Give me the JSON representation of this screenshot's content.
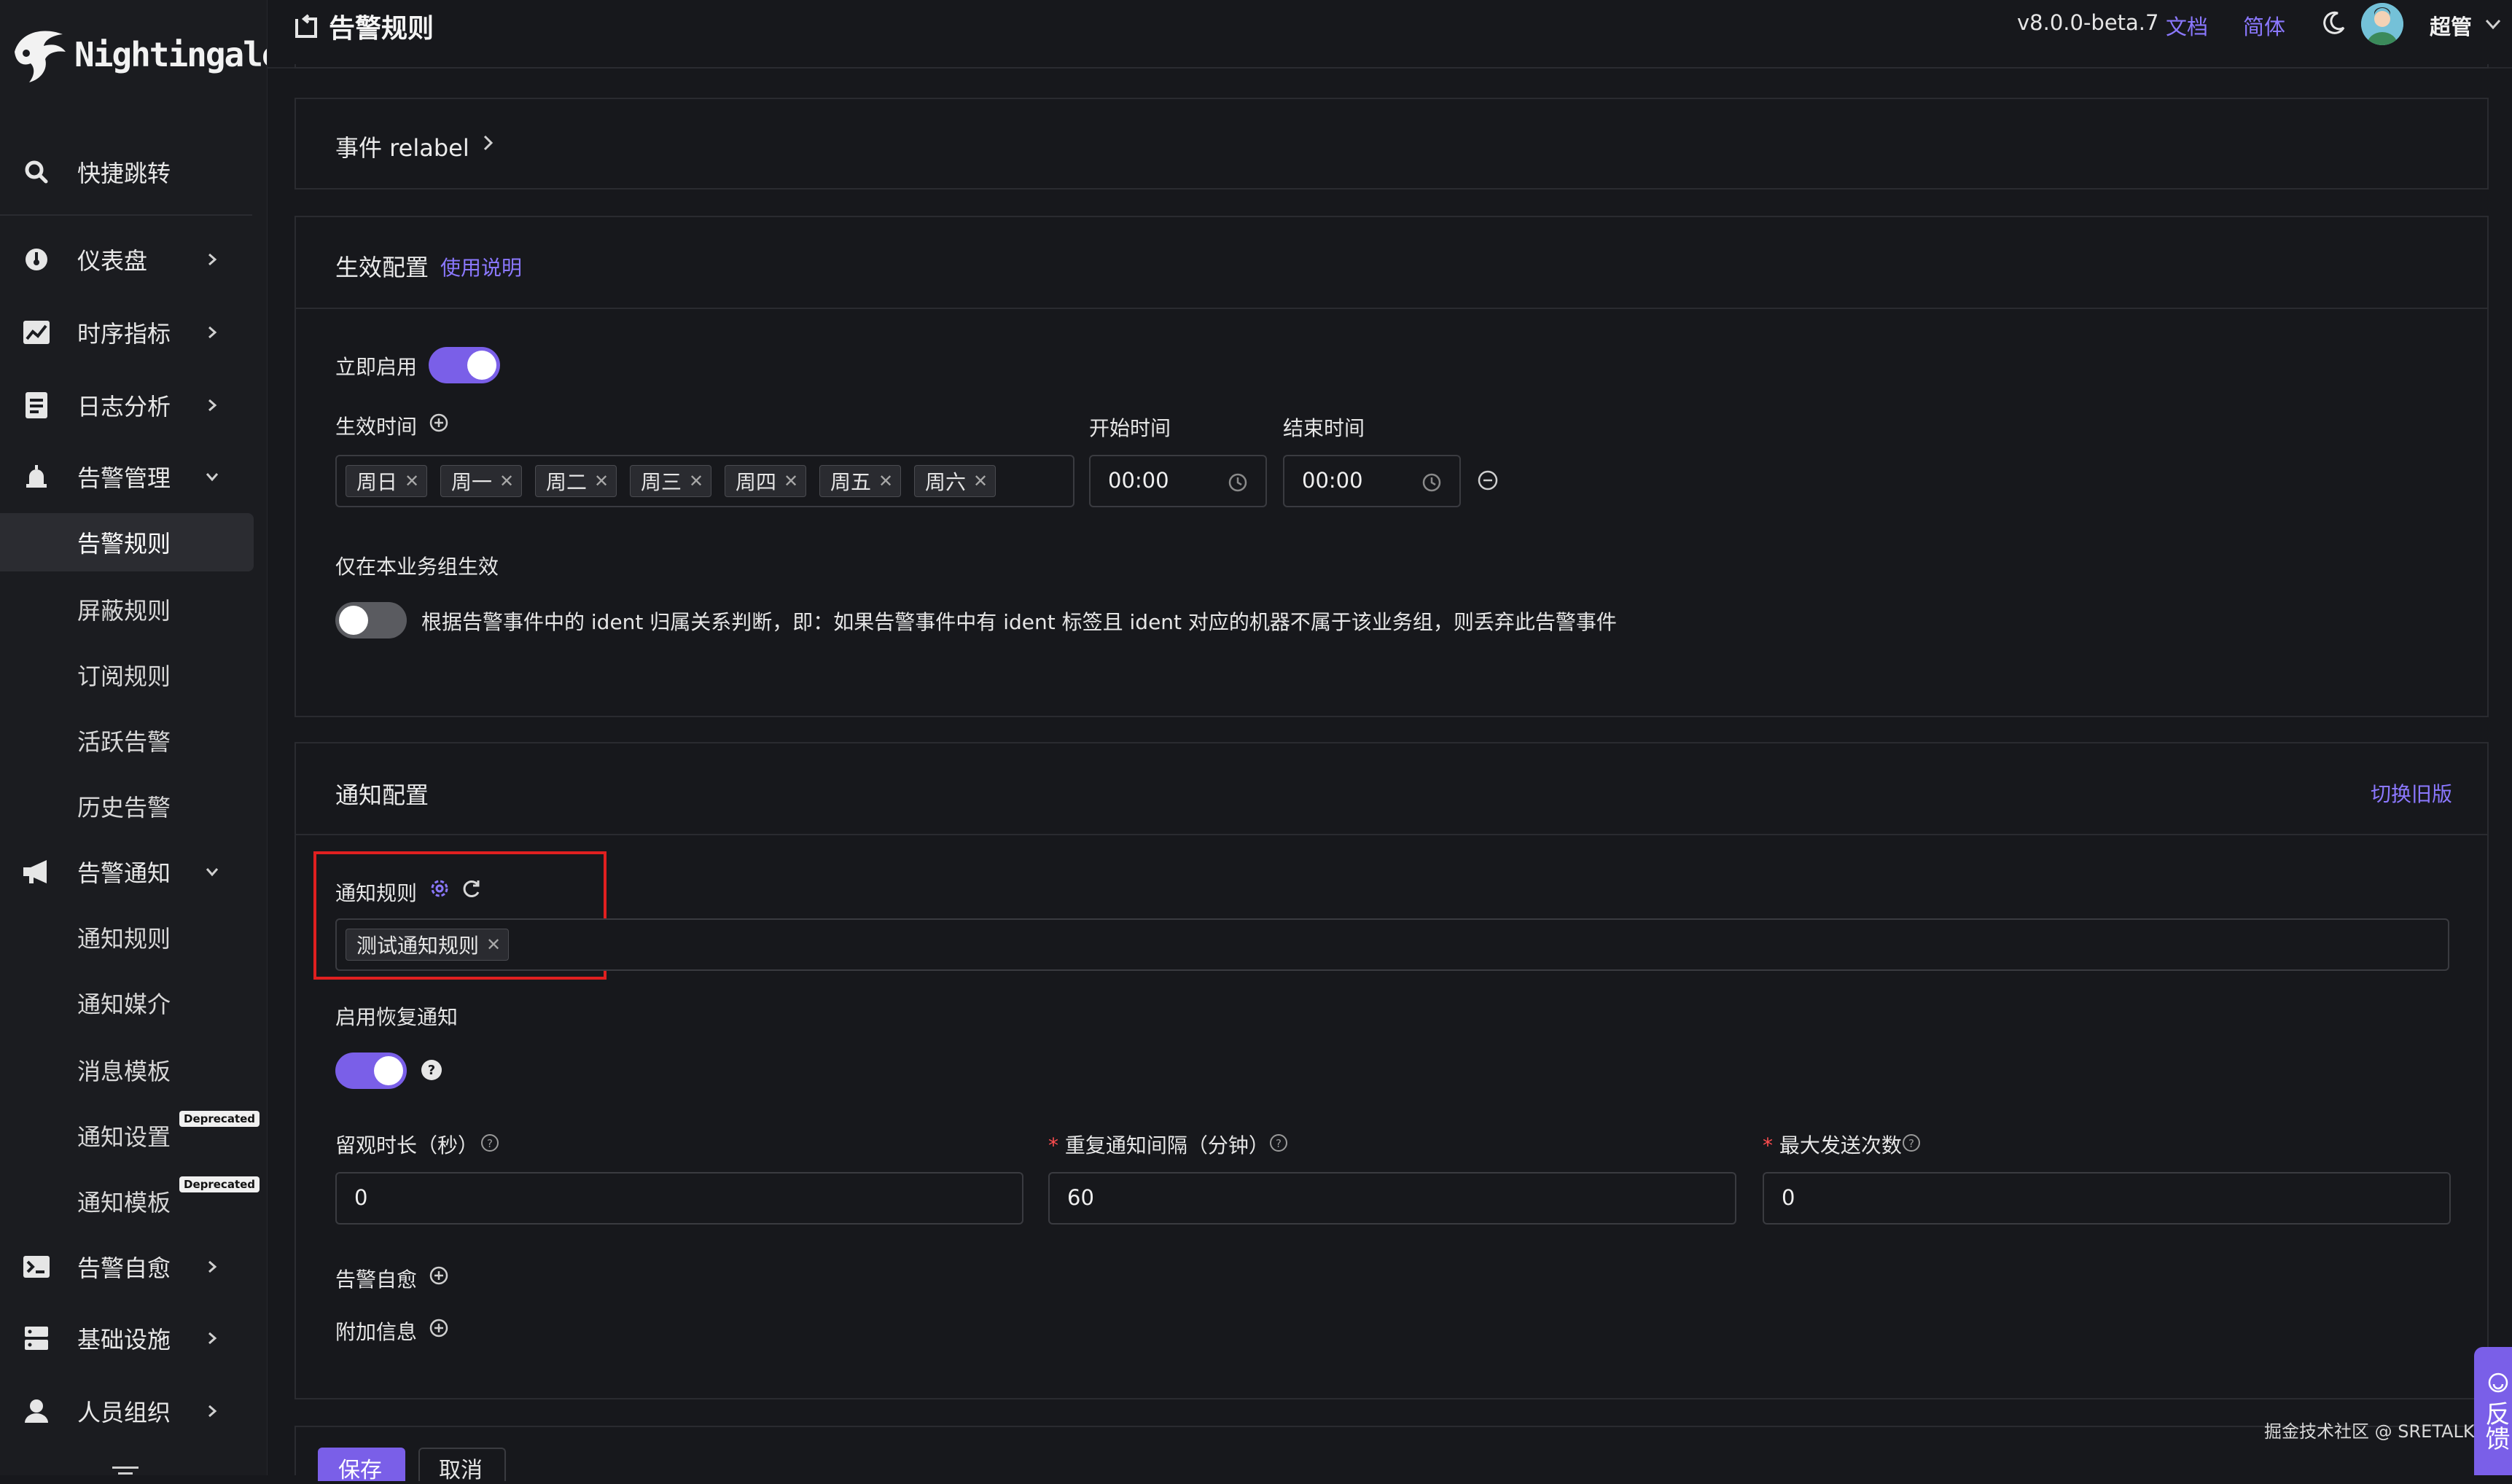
{
  "app": {
    "name": "Nightingale"
  },
  "sidebar": {
    "quick_jump": "快捷跳转",
    "items": [
      {
        "label": "仪表盘",
        "icon": "dashboard-icon"
      },
      {
        "label": "时序指标",
        "icon": "line-chart-icon"
      },
      {
        "label": "日志分析",
        "icon": "log-icon"
      },
      {
        "label": "告警管理",
        "icon": "alarm-bell-icon"
      },
      {
        "label": "告警通知",
        "icon": "megaphone-icon"
      },
      {
        "label": "告警自愈",
        "icon": "terminal-icon"
      },
      {
        "label": "基础设施",
        "icon": "server-icon"
      },
      {
        "label": "人员组织",
        "icon": "user-icon"
      }
    ],
    "alert_mgmt_sub": [
      "告警规则",
      "屏蔽规则",
      "订阅规则",
      "活跃告警",
      "历史告警"
    ],
    "notify_sub": [
      "通知规则",
      "通知媒介",
      "消息模板",
      "通知设置",
      "通知模板"
    ],
    "deprecated_badge": "Deprecated"
  },
  "header": {
    "title": "告警规则",
    "version": "v8.0.0-beta.7",
    "docs_link": "文档",
    "lang_link": "简体",
    "user_name": "超管"
  },
  "relabel": {
    "title": "事件 relabel"
  },
  "effective": {
    "title": "生效配置",
    "help_link": "使用说明",
    "enable_label": "立即启用",
    "enable_on": true,
    "time_label": "生效时间",
    "days": [
      "周日",
      "周一",
      "周二",
      "周三",
      "周四",
      "周五",
      "周六"
    ],
    "start_label": "开始时间",
    "start_value": "00:00",
    "end_label": "结束时间",
    "end_value": "00:00",
    "group_only_label": "仅在本业务组生效",
    "group_only_on": false,
    "group_only_desc": "根据告警事件中的 ident 归属关系判断，即：如果告警事件中有 ident 标签且 ident 对应的机器不属于该业务组，则丢弃此告警事件"
  },
  "notify": {
    "title": "通知配置",
    "switch_link": "切换旧版",
    "rule_label": "通知规则",
    "rules": [
      "测试通知规则"
    ],
    "recovery_label": "启用恢复通知",
    "recovery_on": true,
    "observe_label": "留观时长（秒）",
    "observe_value": "0",
    "repeat_label": "重复通知间隔（分钟）",
    "repeat_value": "60",
    "max_label": "最大发送次数",
    "max_value": "0",
    "self_heal_label": "告警自愈",
    "extra_label": "附加信息"
  },
  "footer": {
    "save": "保存",
    "cancel": "取消",
    "watermark": "掘金技术社区 @ SRETALK",
    "feedback": "反馈"
  },
  "colors": {
    "accent": "#7a5fe8",
    "link": "#8b78ff",
    "highlight_box": "#e02020",
    "background": "#17181c"
  }
}
